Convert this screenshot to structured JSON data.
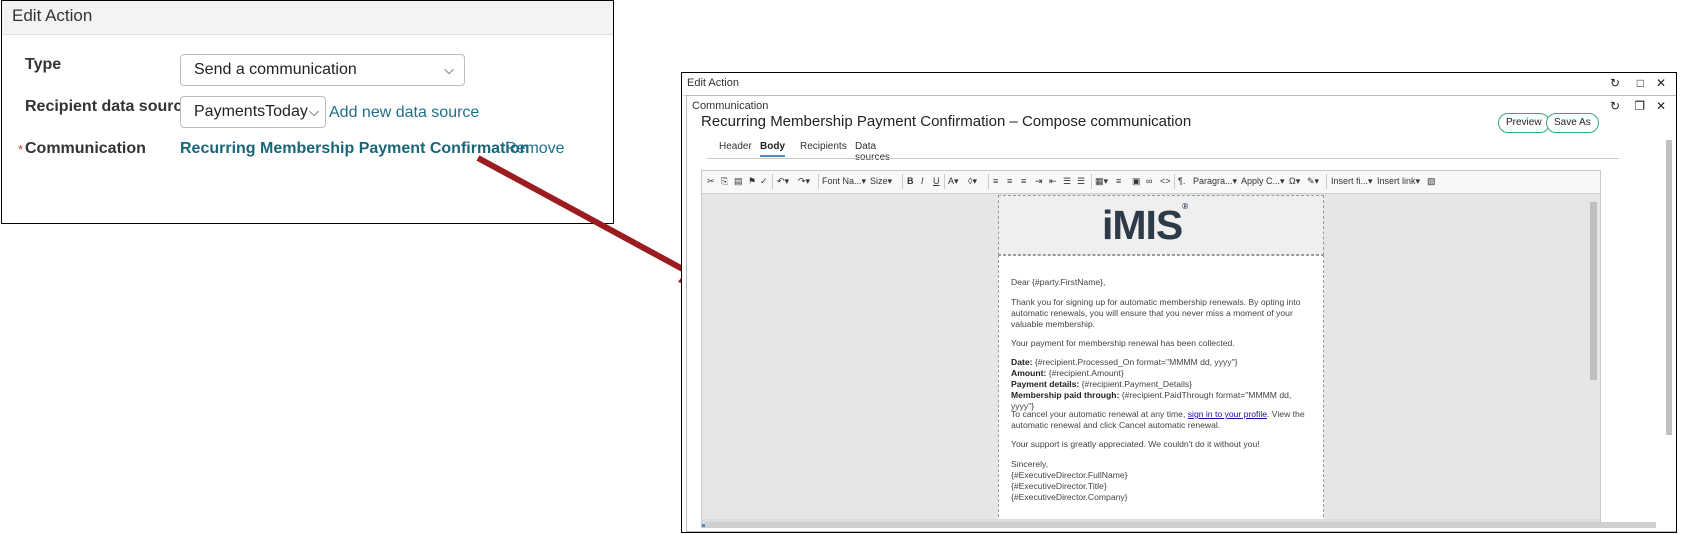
{
  "left": {
    "title": "Edit Action",
    "type_label": "Type",
    "type_value": "Send a communication",
    "source_label": "Recipient data source",
    "source_value": "PaymentsToday",
    "add_source_link": "Add new data source",
    "required_mark": "*",
    "comm_label": "Communication",
    "comm_value": "Recurring Membership Payment Confirmation",
    "remove_link": "Remove"
  },
  "right": {
    "window_title": "Edit Action",
    "inner_title": "Communication",
    "compose_title": "Recurring Membership Payment Confirmation – Compose communication",
    "preview_button": "Preview",
    "save_as_button": "Save As",
    "tabs": [
      "Header",
      "Body",
      "Recipients",
      "Data sources"
    ],
    "active_tab": "Body",
    "toolbar": {
      "font_name": "Font Na...",
      "size": "Size",
      "paragraph": "Paragra...",
      "apply_class": "Apply C...",
      "insert_field": "Insert fi...",
      "insert_link": "Insert link"
    },
    "logo_text": "iMIS",
    "logo_reg": "®",
    "email": {
      "greeting": "Dear {#party.FirstName},",
      "p1": "Thank you for signing up for automatic membership renewals. By opting into automatic renewals, you will ensure that you never miss a moment of your valuable membership.",
      "p2": "Your payment for membership renewal has been collected.",
      "date_label": "Date:",
      "date_value": " {#recipient.Processed_On format=\"MMMM dd, yyyy\"}",
      "amount_label": "Amount:",
      "amount_value": " {#recipient.Amount}",
      "details_label": "Payment details:",
      "details_value": " {#recipient.Payment_Details}",
      "paid_label": "Membership paid through:",
      "paid_value": " {#recipient.PaidThrough format=\"MMMM dd, yyyy\"}",
      "cancel_pre": "To cancel your automatic renewal at any time, ",
      "cancel_link": "sign in to your profile",
      "cancel_post": ". View the automatic renewal and click Cancel automatic renewal.",
      "support": "Your support is greatly appreciated. We couldn't do it without you!",
      "sincerely": "Sincerely,",
      "sig1": "{#ExecutiveDirector.FullName}",
      "sig2": "{#ExecutiveDirector.Title}",
      "sig3": "{#ExecutiveDirector.Company}"
    }
  },
  "colors": {
    "arrow": "#9b1c1f",
    "link": "#1f6f8b",
    "required": "#c0392b",
    "pill_border": "#3aa57a"
  }
}
